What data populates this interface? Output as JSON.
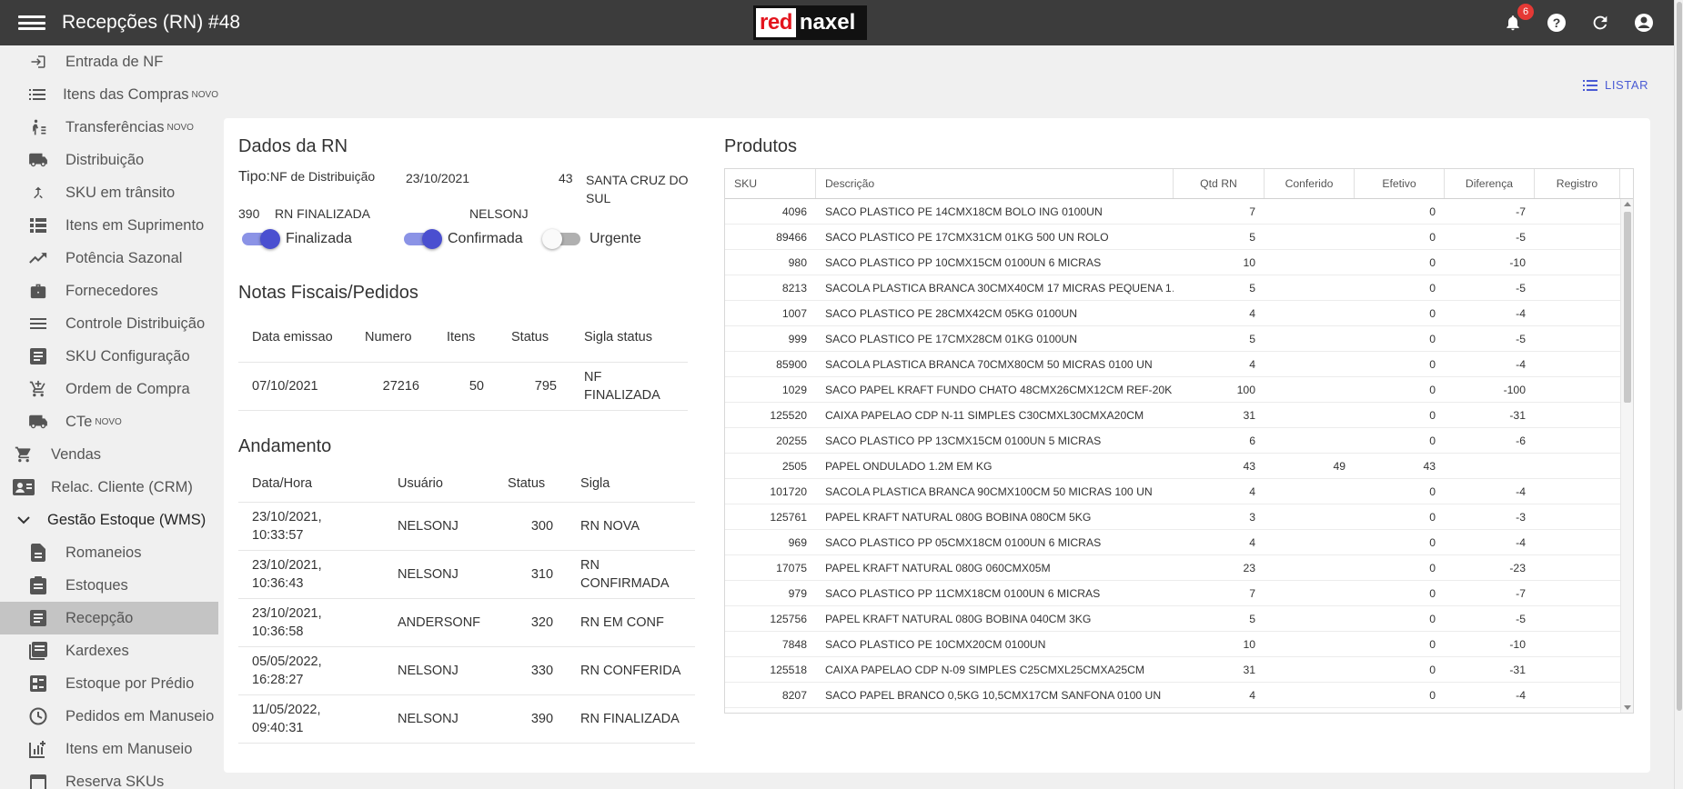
{
  "header": {
    "title": "Recepções (RN) #48",
    "logo_red": "red",
    "logo_naxel": "naxel",
    "notifications_count": "6"
  },
  "sidebar": {
    "items": [
      {
        "label": "Entrada de NF",
        "icon": "login-icon",
        "level": "sub"
      },
      {
        "label": "Itens das Compras",
        "icon": "list-icon",
        "level": "sub",
        "tag": "NOVO"
      },
      {
        "label": "Transferências",
        "icon": "transfer-walk-icon",
        "level": "sub",
        "tag": "NOVO"
      },
      {
        "label": "Distribuição",
        "icon": "truck-icon",
        "level": "sub"
      },
      {
        "label": "SKU em trânsito",
        "icon": "merge-icon",
        "level": "sub"
      },
      {
        "label": "Itens em Suprimento",
        "icon": "view-list-icon",
        "level": "sub"
      },
      {
        "label": "Potência Sazonal",
        "icon": "trending-up-icon",
        "level": "sub"
      },
      {
        "label": "Fornecedores",
        "icon": "briefcase-icon",
        "level": "sub"
      },
      {
        "label": "Controle Distribuição",
        "icon": "lines-icon",
        "level": "sub"
      },
      {
        "label": "SKU Configuração",
        "icon": "article-icon",
        "level": "sub"
      },
      {
        "label": "Ordem de Compra",
        "icon": "cart-add-icon",
        "level": "sub"
      },
      {
        "label": "CTe",
        "icon": "truck-icon",
        "level": "sub",
        "tag": "NOVO"
      },
      {
        "label": "Vendas",
        "icon": "cart-icon",
        "level": "top"
      },
      {
        "label": "Relac. Cliente (CRM)",
        "icon": "contact-card-icon",
        "level": "top"
      },
      {
        "label": "Gestão Estoque (WMS)",
        "icon": "chevron-down-icon",
        "level": "group"
      },
      {
        "label": "Romaneios",
        "icon": "file-icon",
        "level": "sub"
      },
      {
        "label": "Estoques",
        "icon": "clipboard-icon",
        "level": "sub"
      },
      {
        "label": "Recepção",
        "icon": "article-icon",
        "level": "sub",
        "active": true
      },
      {
        "label": "Kardexes",
        "icon": "book-list-icon",
        "level": "sub"
      },
      {
        "label": "Estoque por Prédio",
        "icon": "building-icon",
        "level": "sub"
      },
      {
        "label": "Pedidos em Manuseio",
        "icon": "clock-icon",
        "level": "sub"
      },
      {
        "label": "Itens em Manuseio",
        "icon": "chart-box-icon",
        "level": "sub"
      },
      {
        "label": "Reserva SKUs",
        "icon": "calendar-icon",
        "level": "sub"
      }
    ]
  },
  "actions": {
    "listar": "LISTAR"
  },
  "rn": {
    "section_title": "Dados da RN",
    "tipo_label": "Tipo:",
    "tipo_value": "NF de Distribuição",
    "date": "23/10/2021",
    "filial_code": "43",
    "filial_name": "SANTA CRUZ DO SUL",
    "status_code": "390",
    "status_text": "RN FINALIZADA",
    "user": "NELSONJ",
    "toggles": {
      "finalizada": "Finalizada",
      "confirmada": "Confirmada",
      "urgente": "Urgente"
    }
  },
  "notas": {
    "section_title": "Notas Fiscais/Pedidos",
    "columns": [
      "Data emissao",
      "Numero",
      "Itens",
      "Status",
      "Sigla status"
    ],
    "rows": [
      {
        "data": "07/10/2021",
        "numero": "27216",
        "itens": "50",
        "status": "795",
        "sigla": "NF FINALIZADA"
      }
    ]
  },
  "andamento": {
    "section_title": "Andamento",
    "columns": [
      "Data/Hora",
      "Usuário",
      "Status",
      "Sigla"
    ],
    "rows": [
      {
        "data": "23/10/2021, 10:33:57",
        "usuario": "NELSONJ",
        "status": "300",
        "sigla": "RN NOVA"
      },
      {
        "data": "23/10/2021, 10:36:43",
        "usuario": "NELSONJ",
        "status": "310",
        "sigla": "RN CONFIRMADA"
      },
      {
        "data": "23/10/2021, 10:36:58",
        "usuario": "ANDERSONF",
        "status": "320",
        "sigla": "RN EM CONF"
      },
      {
        "data": "05/05/2022, 16:28:27",
        "usuario": "NELSONJ",
        "status": "330",
        "sigla": "RN CONFERIDA"
      },
      {
        "data": "11/05/2022, 09:40:31",
        "usuario": "NELSONJ",
        "status": "390",
        "sigla": "RN FINALIZADA"
      }
    ]
  },
  "produtos": {
    "section_title": "Produtos",
    "columns": [
      "SKU",
      "Descrição",
      "Qtd RN",
      "Conferido",
      "Efetivo",
      "Diferença",
      "Registro"
    ],
    "rows": [
      {
        "sku": "4096",
        "desc": "SACO PLASTICO PE 14CMX18CM BOLO ING 0100UN",
        "qtd": "7",
        "conf": "",
        "efet": "0",
        "dif": "-7",
        "reg": ""
      },
      {
        "sku": "89466",
        "desc": "SACO PLASTICO PE 17CMX31CM 01KG 500 UN ROLO",
        "qtd": "5",
        "conf": "",
        "efet": "0",
        "dif": "-5",
        "reg": ""
      },
      {
        "sku": "980",
        "desc": "SACO PLASTICO PP 10CMX15CM 0100UN 6 MICRAS",
        "qtd": "10",
        "conf": "",
        "efet": "0",
        "dif": "-10",
        "reg": ""
      },
      {
        "sku": "8213",
        "desc": "SACOLA PLASTICA BRANCA 30CMX40CM 17 MICRAS PEQUENA 1…",
        "qtd": "5",
        "conf": "",
        "efet": "0",
        "dif": "-5",
        "reg": ""
      },
      {
        "sku": "1007",
        "desc": "SACO PLASTICO PE 28CMX42CM 05KG 0100UN",
        "qtd": "4",
        "conf": "",
        "efet": "0",
        "dif": "-4",
        "reg": ""
      },
      {
        "sku": "999",
        "desc": "SACO PLASTICO PE 17CMX28CM 01KG 0100UN",
        "qtd": "5",
        "conf": "",
        "efet": "0",
        "dif": "-5",
        "reg": ""
      },
      {
        "sku": "85900",
        "desc": "SACOLA PLASTICA BRANCA 70CMX80CM 50 MICRAS 0100 UN",
        "qtd": "4",
        "conf": "",
        "efet": "0",
        "dif": "-4",
        "reg": ""
      },
      {
        "sku": "1029",
        "desc": "SACO PAPEL KRAFT FUNDO CHATO 48CMX26CMX12CM REF-20K …",
        "qtd": "100",
        "conf": "",
        "efet": "0",
        "dif": "-100",
        "reg": ""
      },
      {
        "sku": "125520",
        "desc": "CAIXA PAPELAO CDP N-11 SIMPLES C30CMXL30CMXA20CM",
        "qtd": "31",
        "conf": "",
        "efet": "0",
        "dif": "-31",
        "reg": ""
      },
      {
        "sku": "20255",
        "desc": "SACO PLASTICO PP 13CMX15CM 0100UN 5 MICRAS",
        "qtd": "6",
        "conf": "",
        "efet": "0",
        "dif": "-6",
        "reg": ""
      },
      {
        "sku": "2505",
        "desc": "PAPEL ONDULADO 1.2M EM KG",
        "qtd": "43",
        "conf": "49",
        "efet": "43",
        "dif": "",
        "reg": ""
      },
      {
        "sku": "101720",
        "desc": "SACOLA PLASTICA BRANCA 90CMX100CM 50 MICRAS 100 UN",
        "qtd": "4",
        "conf": "",
        "efet": "0",
        "dif": "-4",
        "reg": ""
      },
      {
        "sku": "125761",
        "desc": "PAPEL KRAFT NATURAL 080G BOBINA 080CM 5KG",
        "qtd": "3",
        "conf": "",
        "efet": "0",
        "dif": "-3",
        "reg": ""
      },
      {
        "sku": "969",
        "desc": "SACO PLASTICO PP 05CMX18CM 0100UN 6 MICRAS",
        "qtd": "4",
        "conf": "",
        "efet": "0",
        "dif": "-4",
        "reg": ""
      },
      {
        "sku": "17075",
        "desc": "PAPEL KRAFT NATURAL 080G 060CMX05M",
        "qtd": "23",
        "conf": "",
        "efet": "0",
        "dif": "-23",
        "reg": ""
      },
      {
        "sku": "979",
        "desc": "SACO PLASTICO PP 11CMX18CM 0100UN 6 MICRAS",
        "qtd": "7",
        "conf": "",
        "efet": "0",
        "dif": "-7",
        "reg": ""
      },
      {
        "sku": "125756",
        "desc": "PAPEL KRAFT NATURAL 080G BOBINA 040CM 3KG",
        "qtd": "5",
        "conf": "",
        "efet": "0",
        "dif": "-5",
        "reg": ""
      },
      {
        "sku": "7848",
        "desc": "SACO PLASTICO PE 10CMX20CM 0100UN",
        "qtd": "10",
        "conf": "",
        "efet": "0",
        "dif": "-10",
        "reg": ""
      },
      {
        "sku": "125518",
        "desc": "CAIXA PAPELAO CDP N-09 SIMPLES C25CMXL25CMXA25CM",
        "qtd": "31",
        "conf": "",
        "efet": "0",
        "dif": "-31",
        "reg": ""
      },
      {
        "sku": "8207",
        "desc": "SACO PAPEL BRANCO 0,5KG 10,5CMX17CM SANFONA 0100 UN",
        "qtd": "4",
        "conf": "",
        "efet": "0",
        "dif": "-4",
        "reg": ""
      }
    ]
  },
  "colors": {
    "topbar": "#3c3c3c",
    "accent": "#4a4fd0",
    "active_item": "#c4c4c4",
    "badge": "#e53935"
  }
}
